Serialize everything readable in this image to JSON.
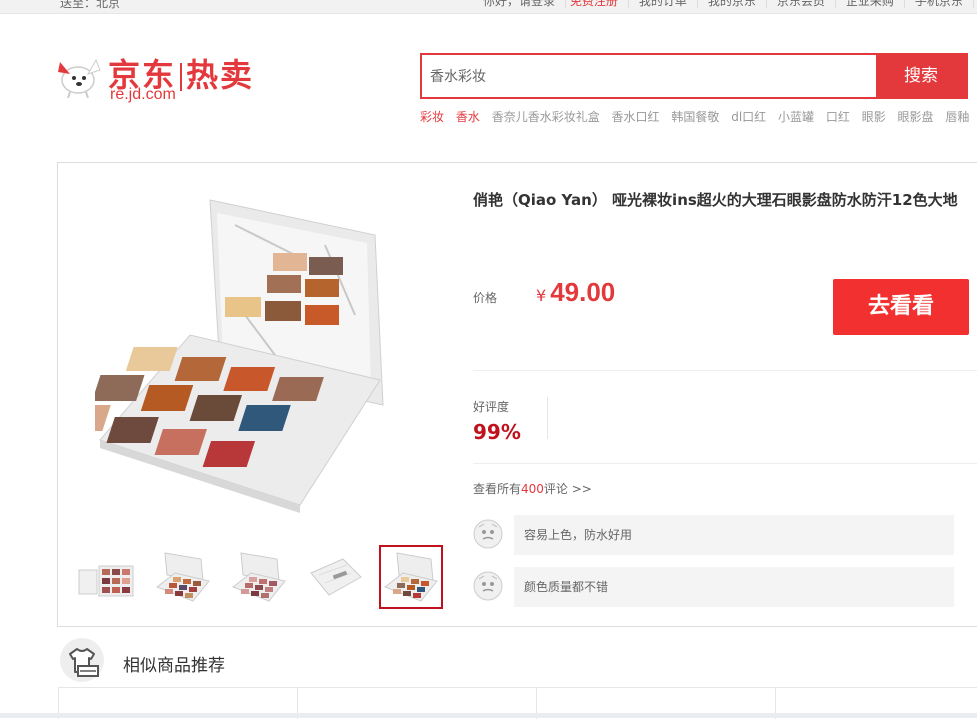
{
  "topbar": {
    "location": "送至：北京",
    "greeting": "你好，请登录",
    "register": "免费注册",
    "links": [
      "我的订单",
      "我的京东",
      "京东会员",
      "企业采购",
      "手机京东"
    ]
  },
  "logo": {
    "brand_left": "京东",
    "brand_right": "热卖",
    "url": "re.jd.com"
  },
  "search": {
    "value": "香水彩妆",
    "button": "搜索"
  },
  "hotwords": [
    "彩妆",
    "香水",
    "香奈儿香水彩妆礼盒",
    "香水口红",
    "韩国餐敬",
    "dl口红",
    "小蓝罐",
    "口红",
    "眼影",
    "眼影盘",
    "唇釉"
  ],
  "product": {
    "title": "俏艳（Qiao Yan） 哑光裸妆ins超火的大理石眼影盘防水防汗12色大地",
    "price_label": "价格",
    "currency": "¥",
    "price": "49.00",
    "goto_button": "去看看",
    "rating_label": "好评度",
    "rating": "99%",
    "all_comments_prefix": "查看所有",
    "all_comments_count": "400",
    "all_comments_suffix": "评论 >>",
    "comments": [
      "容易上色，防水好用",
      "颜色质量都不错"
    ]
  },
  "similar": {
    "title": "相似商品推荐"
  },
  "colors": {
    "accent": "#e4393c",
    "button": "#f23030",
    "rating": "#c0111c"
  }
}
